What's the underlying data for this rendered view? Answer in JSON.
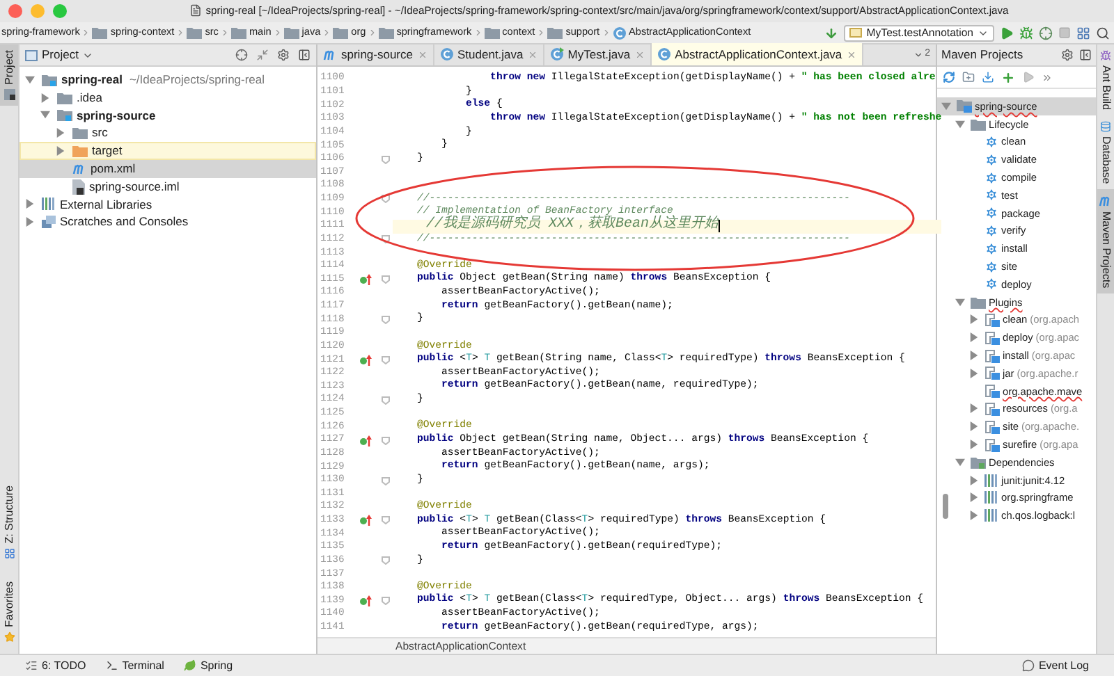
{
  "window": {
    "title": "spring-real [~/IdeaProjects/spring-real] - ~/IdeaProjects/spring-framework/spring-context/src/main/java/org/springframework/context/support/AbstractApplicationContext.java"
  },
  "navigation_bar": {
    "breadcrumbs": [
      {
        "label": "spring-framework",
        "kind": "none"
      },
      {
        "label": "spring-context",
        "kind": "folder"
      },
      {
        "label": "src",
        "kind": "folder"
      },
      {
        "label": "main",
        "kind": "folder"
      },
      {
        "label": "java",
        "kind": "folder"
      },
      {
        "label": "org",
        "kind": "folder"
      },
      {
        "label": "springframework",
        "kind": "folder"
      },
      {
        "label": "context",
        "kind": "folder"
      },
      {
        "label": "support",
        "kind": "folder"
      },
      {
        "label": "AbstractApplicationContext",
        "kind": "class"
      }
    ],
    "run_configuration": "MyTest.testAnnotation"
  },
  "left_tool_strip": {
    "top": [
      {
        "label": "Project",
        "selected": true,
        "kind": "project"
      }
    ],
    "bottom": [
      {
        "label": "Z: Structure",
        "selected": false,
        "kind": "structure"
      },
      {
        "label": "Favorites",
        "selected": false,
        "kind": "favorites"
      }
    ]
  },
  "project_panel": {
    "title": "Project",
    "tree": [
      {
        "label": "spring-real",
        "detail": "~/IdeaProjects/spring-real",
        "bold": true,
        "kind": "module",
        "expanded": true,
        "selected": false,
        "highlighted": false,
        "children": [
          {
            "label": ".idea",
            "bold": false,
            "kind": "folder",
            "expanded": false,
            "selected": false,
            "highlighted": false
          },
          {
            "label": "spring-source",
            "bold": true,
            "kind": "module",
            "expanded": true,
            "selected": false,
            "highlighted": false,
            "children": [
              {
                "label": "src",
                "bold": false,
                "kind": "folder",
                "expanded": false,
                "selected": false,
                "highlighted": false
              },
              {
                "label": "target",
                "bold": false,
                "kind": "excluded-folder",
                "expanded": false,
                "selected": false,
                "highlighted": true
              },
              {
                "label": "pom.xml",
                "bold": false,
                "kind": "maven-file",
                "selected": true,
                "highlighted": false
              },
              {
                "label": "spring-source.iml",
                "bold": false,
                "kind": "iml-file",
                "selected": false,
                "highlighted": false
              }
            ]
          }
        ]
      },
      {
        "label": "External Libraries",
        "bold": false,
        "kind": "libraries",
        "expanded": false,
        "selected": false,
        "highlighted": false
      },
      {
        "label": "Scratches and Consoles",
        "bold": false,
        "kind": "scratches",
        "expanded": false,
        "selected": false,
        "highlighted": false
      }
    ]
  },
  "editor": {
    "tabs": [
      {
        "label": "spring-source",
        "kind": "maven",
        "selected": false
      },
      {
        "label": "Student.java",
        "kind": "class",
        "selected": false
      },
      {
        "label": "MyTest.java",
        "kind": "test-class",
        "selected": false
      },
      {
        "label": "AbstractApplicationContext.java",
        "kind": "class",
        "selected": true
      }
    ],
    "overflow_count": "2",
    "lines": [
      {
        "number": "1100",
        "current": false,
        "fold": false,
        "gutter_icon": false,
        "tokens": [
          {
            "kind": "kw",
            "text": "                throw new"
          },
          {
            "kind": "plain",
            "text": " IllegalStateException(getDisplayName() + "
          },
          {
            "kind": "str",
            "text": "\" has been closed alre"
          }
        ]
      },
      {
        "number": "1101",
        "current": false,
        "fold": false,
        "gutter_icon": false,
        "tokens": [
          {
            "kind": "plain",
            "text": "            }"
          }
        ]
      },
      {
        "number": "1102",
        "current": false,
        "fold": false,
        "gutter_icon": false,
        "tokens": [
          {
            "kind": "kw",
            "text": "            else"
          },
          {
            "kind": "plain",
            "text": " {"
          }
        ]
      },
      {
        "number": "1103",
        "current": false,
        "fold": false,
        "gutter_icon": false,
        "tokens": [
          {
            "kind": "kw",
            "text": "                throw new"
          },
          {
            "kind": "plain",
            "text": " IllegalStateException(getDisplayName() + "
          },
          {
            "kind": "str",
            "text": "\" has not been refreshe"
          }
        ]
      },
      {
        "number": "1104",
        "current": false,
        "fold": false,
        "gutter_icon": false,
        "tokens": [
          {
            "kind": "plain",
            "text": "            }"
          }
        ]
      },
      {
        "number": "1105",
        "current": false,
        "fold": false,
        "gutter_icon": false,
        "tokens": [
          {
            "kind": "plain",
            "text": "        }"
          }
        ]
      },
      {
        "number": "1106",
        "current": false,
        "fold": true,
        "gutter_icon": false,
        "tokens": [
          {
            "kind": "plain",
            "text": "    }"
          }
        ]
      },
      {
        "number": "1107",
        "current": false,
        "fold": false,
        "gutter_icon": false
      },
      {
        "number": "1108",
        "current": false,
        "fold": false,
        "gutter_icon": false
      },
      {
        "number": "1109",
        "current": false,
        "fold": true,
        "gutter_icon": false,
        "tokens": [
          {
            "kind": "cmt",
            "text": "    //---------------------------------------------------------------------"
          }
        ]
      },
      {
        "number": "1110",
        "current": false,
        "fold": false,
        "gutter_icon": false,
        "tokens": [
          {
            "kind": "cmt",
            "text": "    // Implementation of BeanFactory interface"
          }
        ]
      },
      {
        "number": "1111",
        "current": true,
        "fold": false,
        "gutter_icon": false,
        "tokens": [
          {
            "kind": "cmt",
            "text": "    //我是源码研究员 XXX，获取Bean从这里开始"
          }
        ]
      },
      {
        "number": "1112",
        "current": false,
        "fold": true,
        "gutter_icon": false,
        "tokens": [
          {
            "kind": "cmt",
            "text": "    //---------------------------------------------------------------------"
          }
        ]
      },
      {
        "number": "1113",
        "current": false,
        "fold": false,
        "gutter_icon": false
      },
      {
        "number": "1114",
        "current": false,
        "fold": false,
        "gutter_icon": false,
        "tokens": [
          {
            "kind": "ann",
            "text": "    @Override"
          }
        ]
      },
      {
        "number": "1115",
        "current": false,
        "fold": true,
        "gutter_icon": true,
        "tokens": [
          {
            "kind": "kw",
            "text": "    public"
          },
          {
            "kind": "plain",
            "text": " Object getBean(String name) "
          },
          {
            "kind": "kw",
            "text": "throws"
          },
          {
            "kind": "plain",
            "text": " BeansException {"
          }
        ]
      },
      {
        "number": "1116",
        "current": false,
        "fold": false,
        "gutter_icon": false,
        "tokens": [
          {
            "kind": "plain",
            "text": "        assertBeanFactoryActive();"
          }
        ]
      },
      {
        "number": "1117",
        "current": false,
        "fold": false,
        "gutter_icon": false,
        "tokens": [
          {
            "kind": "kw",
            "text": "        return"
          },
          {
            "kind": "plain",
            "text": " getBeanFactory().getBean(name);"
          }
        ]
      },
      {
        "number": "1118",
        "current": false,
        "fold": true,
        "gutter_icon": false,
        "tokens": [
          {
            "kind": "plain",
            "text": "    }"
          }
        ]
      },
      {
        "number": "1119",
        "current": false,
        "fold": false,
        "gutter_icon": false
      },
      {
        "number": "1120",
        "current": false,
        "fold": false,
        "gutter_icon": false,
        "tokens": [
          {
            "kind": "ann",
            "text": "    @Override"
          }
        ]
      },
      {
        "number": "1121",
        "current": false,
        "fold": true,
        "gutter_icon": true,
        "tokens": [
          {
            "kind": "kw",
            "text": "    public"
          },
          {
            "kind": "plain",
            "text": " <"
          },
          {
            "kind": "tp",
            "text": "T"
          },
          {
            "kind": "plain",
            "text": "> "
          },
          {
            "kind": "tp",
            "text": "T"
          },
          {
            "kind": "plain",
            "text": " getBean(String name, Class<"
          },
          {
            "kind": "tp",
            "text": "T"
          },
          {
            "kind": "plain",
            "text": "> requiredType) "
          },
          {
            "kind": "kw",
            "text": "throws"
          },
          {
            "kind": "plain",
            "text": " BeansException {"
          }
        ]
      },
      {
        "number": "1122",
        "current": false,
        "fold": false,
        "gutter_icon": false,
        "tokens": [
          {
            "kind": "plain",
            "text": "        assertBeanFactoryActive();"
          }
        ]
      },
      {
        "number": "1123",
        "current": false,
        "fold": false,
        "gutter_icon": false,
        "tokens": [
          {
            "kind": "kw",
            "text": "        return"
          },
          {
            "kind": "plain",
            "text": " getBeanFactory().getBean(name, requiredType);"
          }
        ]
      },
      {
        "number": "1124",
        "current": false,
        "fold": true,
        "gutter_icon": false,
        "tokens": [
          {
            "kind": "plain",
            "text": "    }"
          }
        ]
      },
      {
        "number": "1125",
        "current": false,
        "fold": false,
        "gutter_icon": false
      },
      {
        "number": "1126",
        "current": false,
        "fold": false,
        "gutter_icon": false,
        "tokens": [
          {
            "kind": "ann",
            "text": "    @Override"
          }
        ]
      },
      {
        "number": "1127",
        "current": false,
        "fold": true,
        "gutter_icon": true,
        "tokens": [
          {
            "kind": "kw",
            "text": "    public"
          },
          {
            "kind": "plain",
            "text": " Object getBean(String name, Object... args) "
          },
          {
            "kind": "kw",
            "text": "throws"
          },
          {
            "kind": "plain",
            "text": " BeansException {"
          }
        ]
      },
      {
        "number": "1128",
        "current": false,
        "fold": false,
        "gutter_icon": false,
        "tokens": [
          {
            "kind": "plain",
            "text": "        assertBeanFactoryActive();"
          }
        ]
      },
      {
        "number": "1129",
        "current": false,
        "fold": false,
        "gutter_icon": false,
        "tokens": [
          {
            "kind": "kw",
            "text": "        return"
          },
          {
            "kind": "plain",
            "text": " getBeanFactory().getBean(name, args);"
          }
        ]
      },
      {
        "number": "1130",
        "current": false,
        "fold": true,
        "gutter_icon": false,
        "tokens": [
          {
            "kind": "plain",
            "text": "    }"
          }
        ]
      },
      {
        "number": "1131",
        "current": false,
        "fold": false,
        "gutter_icon": false
      },
      {
        "number": "1132",
        "current": false,
        "fold": false,
        "gutter_icon": false,
        "tokens": [
          {
            "kind": "ann",
            "text": "    @Override"
          }
        ]
      },
      {
        "number": "1133",
        "current": false,
        "fold": true,
        "gutter_icon": true,
        "tokens": [
          {
            "kind": "kw",
            "text": "    public"
          },
          {
            "kind": "plain",
            "text": " <"
          },
          {
            "kind": "tp",
            "text": "T"
          },
          {
            "kind": "plain",
            "text": "> "
          },
          {
            "kind": "tp",
            "text": "T"
          },
          {
            "kind": "plain",
            "text": " getBean(Class<"
          },
          {
            "kind": "tp",
            "text": "T"
          },
          {
            "kind": "plain",
            "text": "> requiredType) "
          },
          {
            "kind": "kw",
            "text": "throws"
          },
          {
            "kind": "plain",
            "text": " BeansException {"
          }
        ]
      },
      {
        "number": "1134",
        "current": false,
        "fold": false,
        "gutter_icon": false,
        "tokens": [
          {
            "kind": "plain",
            "text": "        assertBeanFactoryActive();"
          }
        ]
      },
      {
        "number": "1135",
        "current": false,
        "fold": false,
        "gutter_icon": false,
        "tokens": [
          {
            "kind": "kw",
            "text": "        return"
          },
          {
            "kind": "plain",
            "text": " getBeanFactory().getBean(requiredType);"
          }
        ]
      },
      {
        "number": "1136",
        "current": false,
        "fold": true,
        "gutter_icon": false,
        "tokens": [
          {
            "kind": "plain",
            "text": "    }"
          }
        ]
      },
      {
        "number": "1137",
        "current": false,
        "fold": false,
        "gutter_icon": false
      },
      {
        "number": "1138",
        "current": false,
        "fold": false,
        "gutter_icon": false,
        "tokens": [
          {
            "kind": "ann",
            "text": "    @Override"
          }
        ]
      },
      {
        "number": "1139",
        "current": false,
        "fold": true,
        "gutter_icon": true,
        "tokens": [
          {
            "kind": "kw",
            "text": "    public"
          },
          {
            "kind": "plain",
            "text": " <"
          },
          {
            "kind": "tp",
            "text": "T"
          },
          {
            "kind": "plain",
            "text": "> "
          },
          {
            "kind": "tp",
            "text": "T"
          },
          {
            "kind": "plain",
            "text": " getBean(Class<"
          },
          {
            "kind": "tp",
            "text": "T"
          },
          {
            "kind": "plain",
            "text": "> requiredType, Object... args) "
          },
          {
            "kind": "kw",
            "text": "throws"
          },
          {
            "kind": "plain",
            "text": " BeansException {"
          }
        ]
      },
      {
        "number": "1140",
        "current": false,
        "fold": false,
        "gutter_icon": false,
        "tokens": [
          {
            "kind": "plain",
            "text": "        assertBeanFactoryActive();"
          }
        ]
      },
      {
        "number": "1141",
        "current": false,
        "fold": false,
        "gutter_icon": false,
        "tokens": [
          {
            "kind": "kw",
            "text": "        return"
          },
          {
            "kind": "plain",
            "text": " getBeanFactory().getBean(requiredType, args);"
          }
        ]
      }
    ],
    "breadcrumb": "AbstractApplicationContext"
  },
  "maven_panel": {
    "title": "Maven Projects",
    "tree": [
      {
        "label": "spring-source",
        "kind": "project",
        "expanded": true,
        "selected": true,
        "problem": true,
        "children": [
          {
            "label": "Lifecycle",
            "kind": "folder",
            "expanded": true,
            "selected": false,
            "problem": false,
            "children": [
              {
                "label": "clean",
                "kind": "goal",
                "selected": false,
                "problem": false
              },
              {
                "label": "validate",
                "kind": "goal",
                "selected": false,
                "problem": false
              },
              {
                "label": "compile",
                "kind": "goal",
                "selected": false,
                "problem": false
              },
              {
                "label": "test",
                "kind": "goal",
                "selected": false,
                "problem": false
              },
              {
                "label": "package",
                "kind": "goal",
                "selected": false,
                "problem": false
              },
              {
                "label": "verify",
                "kind": "goal",
                "selected": false,
                "problem": false
              },
              {
                "label": "install",
                "kind": "goal",
                "selected": false,
                "problem": false
              },
              {
                "label": "site",
                "kind": "goal",
                "selected": false,
                "problem": false
              },
              {
                "label": "deploy",
                "kind": "goal",
                "selected": false,
                "problem": false
              }
            ]
          },
          {
            "label": "Plugins",
            "kind": "folder",
            "expanded": true,
            "selected": false,
            "problem": true,
            "children": [
              {
                "label": "clean",
                "detail": "(org.apach",
                "kind": "plugin",
                "expanded": false,
                "selected": false,
                "problem": false
              },
              {
                "label": "deploy",
                "detail": "(org.apac",
                "kind": "plugin",
                "expanded": false,
                "selected": false,
                "problem": false
              },
              {
                "label": "install",
                "detail": "(org.apac",
                "kind": "plugin",
                "expanded": false,
                "selected": false,
                "problem": false
              },
              {
                "label": "jar",
                "detail": "(org.apache.r",
                "kind": "plugin",
                "expanded": false,
                "selected": false,
                "problem": false
              },
              {
                "label": "org.apache.mave",
                "kind": "plugin",
                "selected": false,
                "problem": true
              },
              {
                "label": "resources",
                "detail": "(org.a",
                "kind": "plugin",
                "expanded": false,
                "selected": false,
                "problem": false
              },
              {
                "label": "site",
                "detail": "(org.apache.",
                "kind": "plugin",
                "expanded": false,
                "selected": false,
                "problem": false
              },
              {
                "label": "surefire",
                "detail": "(org.apa",
                "kind": "plugin",
                "expanded": false,
                "selected": false,
                "problem": false
              }
            ]
          },
          {
            "label": "Dependencies",
            "kind": "dependencies",
            "expanded": true,
            "selected": false,
            "problem": false,
            "children": [
              {
                "label": "junit:junit:4.12",
                "kind": "dependency",
                "expanded": false,
                "selected": false,
                "problem": false
              },
              {
                "label": "org.springframe",
                "kind": "dependency",
                "expanded": false,
                "selected": false,
                "problem": false
              },
              {
                "label": "ch.qos.logback:l",
                "kind": "dependency",
                "expanded": false,
                "selected": false,
                "problem": false
              }
            ]
          }
        ]
      }
    ]
  },
  "right_tool_strip": [
    {
      "label": "Ant Build",
      "selected": false,
      "kind": "ant"
    },
    {
      "label": "Database",
      "selected": false,
      "kind": "database"
    },
    {
      "label": "Maven Projects",
      "selected": true,
      "kind": "maven"
    }
  ],
  "bottom_bar": {
    "left": [
      {
        "label": "6: TODO",
        "kind": "todo"
      },
      {
        "label": "Terminal",
        "kind": "terminal"
      },
      {
        "label": "Spring",
        "kind": "spring"
      }
    ],
    "right": [
      {
        "label": "Event Log",
        "kind": "event-log"
      }
    ]
  }
}
